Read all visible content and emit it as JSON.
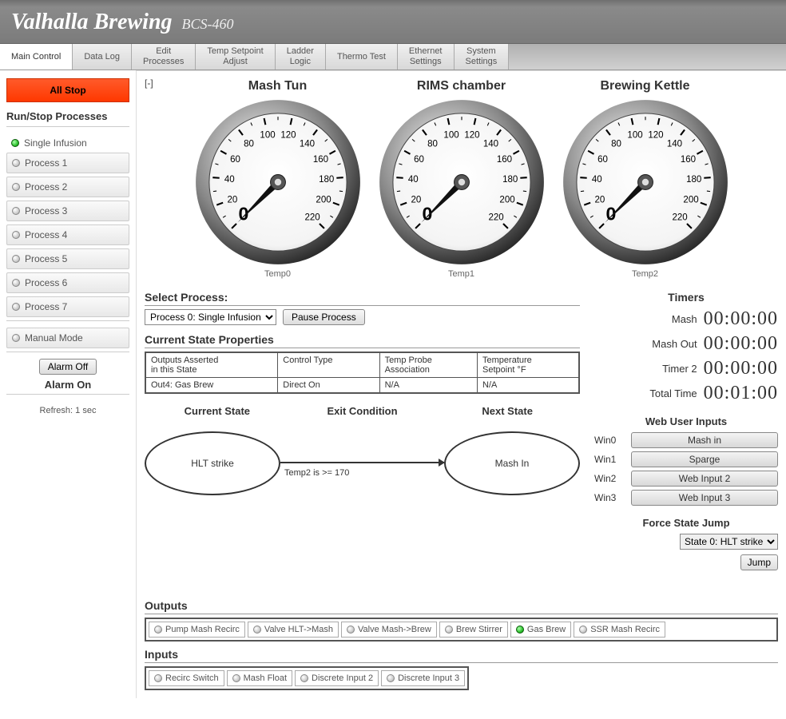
{
  "header": {
    "title": "Valhalla Brewing",
    "model": "BCS-460"
  },
  "tabs": [
    "Main Control",
    "Data Log",
    "Edit\nProcesses",
    "Temp Setpoint\nAdjust",
    "Ladder\nLogic",
    "Thermo Test",
    "Ethernet\nSettings",
    "System\nSettings"
  ],
  "sidebar": {
    "all_stop": "All Stop",
    "run_stop": "Run/Stop Processes",
    "active_process": "Single Infusion",
    "processes": [
      "Process 1",
      "Process 2",
      "Process 3",
      "Process 4",
      "Process 5",
      "Process 6",
      "Process 7"
    ],
    "manual_mode": "Manual Mode",
    "alarm_off": "Alarm Off",
    "alarm_on": "Alarm On",
    "refresh": "Refresh: 1 sec"
  },
  "collapse": "[-]",
  "gauges": [
    {
      "title": "Mash Tun",
      "label": "Temp0",
      "value": 0
    },
    {
      "title": "RIMS chamber",
      "label": "Temp1",
      "value": 0
    },
    {
      "title": "Brewing Kettle",
      "label": "Temp2",
      "value": 0
    }
  ],
  "gauge_scale": {
    "min": 0,
    "max": 220,
    "ticks": [
      0,
      20,
      40,
      60,
      80,
      100,
      120,
      140,
      160,
      180,
      200,
      220
    ]
  },
  "select_process": {
    "label": "Select Process:",
    "selected": "Process 0: Single Infusion",
    "pause": "Pause Process"
  },
  "current_state_props": {
    "title": "Current State Properties",
    "headers": [
      "Outputs Asserted\nin this State",
      "Control Type",
      "Temp Probe\nAssociation",
      "Temperature\nSetpoint °F"
    ],
    "row": [
      "Out4: Gas Brew",
      "Direct On",
      "N/A",
      "N/A"
    ]
  },
  "state_diagram": {
    "labels": [
      "Current State",
      "Exit Condition",
      "Next State"
    ],
    "current": "HLT strike",
    "exit": "Temp2 is >= 170",
    "next": "Mash In"
  },
  "timers": {
    "title": "Timers",
    "items": [
      {
        "name": "Mash",
        "value": "00:00:00"
      },
      {
        "name": "Mash Out",
        "value": "00:00:00"
      },
      {
        "name": "Timer 2",
        "value": "00:00:00"
      },
      {
        "name": "Total Time",
        "value": "00:01:00"
      }
    ]
  },
  "web_inputs": {
    "title": "Web User Inputs",
    "items": [
      {
        "id": "Win0",
        "label": "Mash in"
      },
      {
        "id": "Win1",
        "label": "Sparge"
      },
      {
        "id": "Win2",
        "label": "Web Input 2"
      },
      {
        "id": "Win3",
        "label": "Web Input 3"
      }
    ]
  },
  "force_jump": {
    "title": "Force State Jump",
    "selected": "State 0: HLT strike",
    "button": "Jump"
  },
  "outputs": {
    "title": "Outputs",
    "items": [
      {
        "label": "Pump Mash Recirc",
        "on": false
      },
      {
        "label": "Valve HLT->Mash",
        "on": false
      },
      {
        "label": "Valve Mash->Brew",
        "on": false
      },
      {
        "label": "Brew Stirrer",
        "on": false
      },
      {
        "label": "Gas Brew",
        "on": true
      },
      {
        "label": "SSR Mash Recirc",
        "on": false
      }
    ]
  },
  "inputs": {
    "title": "Inputs",
    "items": [
      {
        "label": "Recirc Switch",
        "on": false
      },
      {
        "label": "Mash Float",
        "on": false
      },
      {
        "label": "Discrete Input 2",
        "on": false
      },
      {
        "label": "Discrete Input 3",
        "on": false
      }
    ]
  }
}
